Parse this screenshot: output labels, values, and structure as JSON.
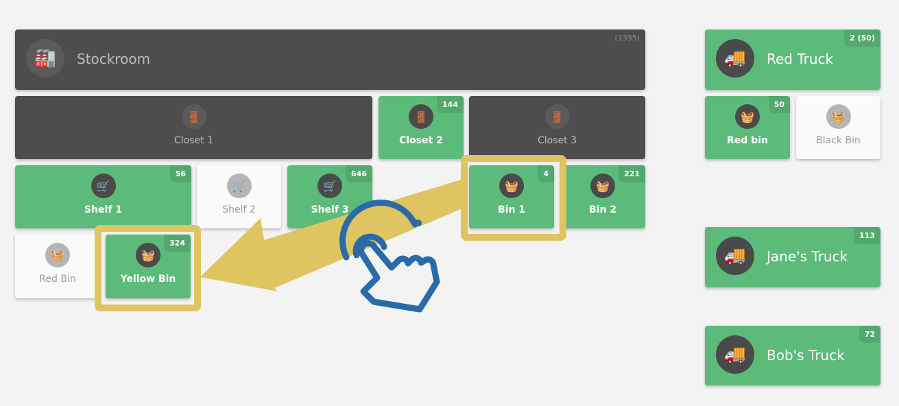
{
  "stockroom": {
    "label": "Stockroom",
    "count": "(1395)",
    "icon": "warehouse-icon"
  },
  "locations": [
    {
      "label": "Closet 1",
      "count": "",
      "state": "empty",
      "icon": "closet-icon"
    },
    {
      "label": "Closet 2",
      "count": "144",
      "state": "active",
      "icon": "closet-icon"
    },
    {
      "label": "Closet 3",
      "count": "",
      "state": "empty",
      "icon": "closet-icon"
    },
    {
      "label": "Shelf 1",
      "count": "56",
      "state": "active",
      "icon": "shelf-icon"
    },
    {
      "label": "Shelf 2",
      "count": "",
      "state": "empty",
      "icon": "shelf-icon"
    },
    {
      "label": "Shelf 3",
      "count": "646",
      "state": "active",
      "icon": "shelf-icon"
    },
    {
      "label": "Bin 1",
      "count": "4",
      "state": "active",
      "icon": "bin-icon"
    },
    {
      "label": "Bin 2",
      "count": "221",
      "state": "active",
      "icon": "bin-icon"
    },
    {
      "label": "Red Bin",
      "count": "",
      "state": "empty",
      "icon": "bin-icon"
    },
    {
      "label": "Yellow Bin",
      "count": "324",
      "state": "active",
      "icon": "bin-icon"
    }
  ],
  "trucks": [
    {
      "label": "Red Truck",
      "count": "2 (50)",
      "icon": "truck-icon",
      "bins": [
        {
          "label": "Red bin",
          "count": "50",
          "state": "active"
        },
        {
          "label": "Black Bin",
          "count": "",
          "state": "empty"
        }
      ]
    },
    {
      "label": "Jane's Truck",
      "count": "113",
      "icon": "truck-icon"
    },
    {
      "label": "Bob's Truck",
      "count": "72",
      "icon": "truck-icon"
    }
  ],
  "colors": {
    "green": "#5cbb7a",
    "dark": "#4d4d4d",
    "highlight": "#dfc462",
    "hand": "#2a6aa8"
  }
}
